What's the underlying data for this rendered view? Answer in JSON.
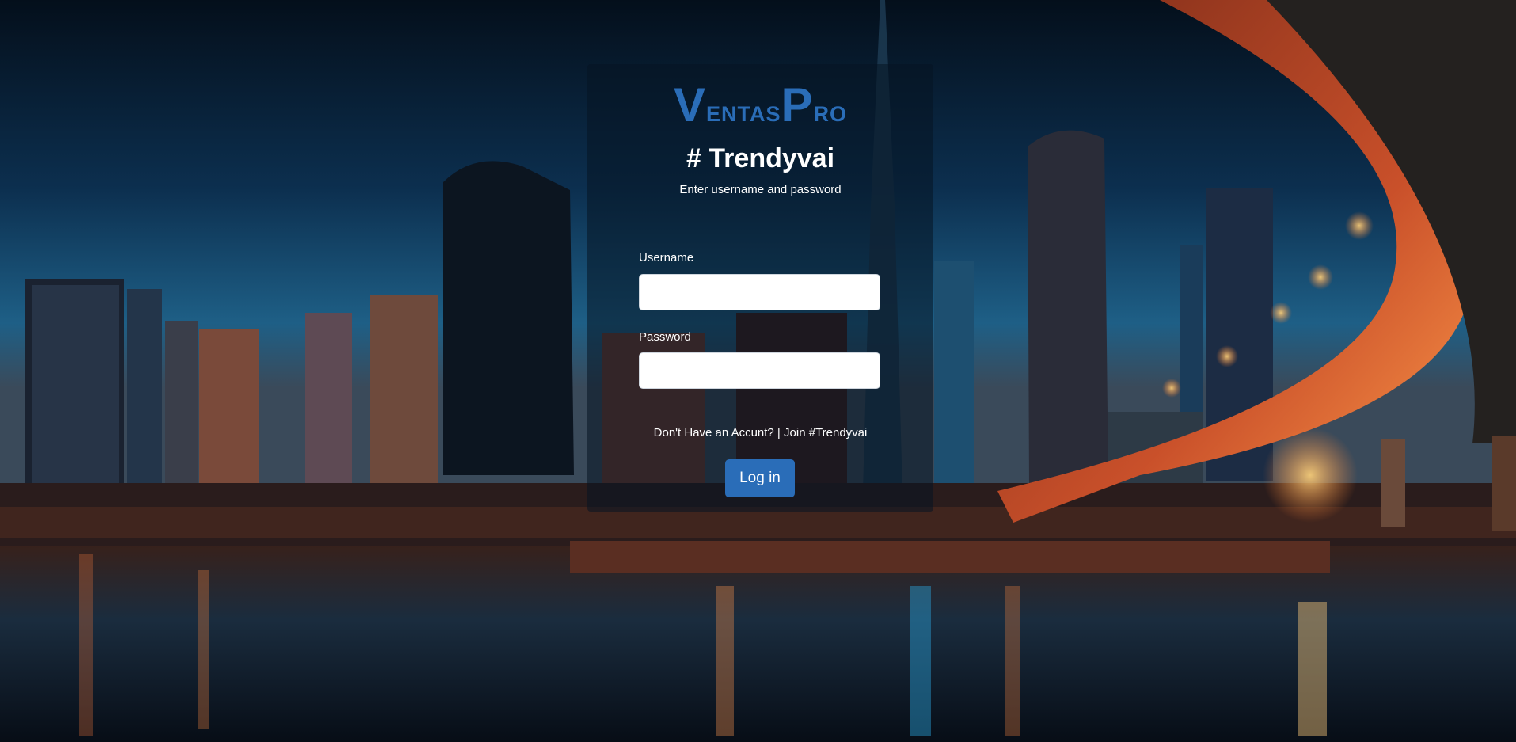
{
  "brand": {
    "logo_text_1": "V",
    "logo_text_2": "entas",
    "logo_text_3": "P",
    "logo_text_4": "ro"
  },
  "page": {
    "title": "# Trendyvai",
    "subtitle": "Enter username and password"
  },
  "form": {
    "username_label": "Username",
    "username_value": "",
    "password_label": "Password",
    "password_value": "",
    "signup_prompt": "Don't Have  an Accunt? |",
    "signup_link": "Join #Trendyvai",
    "submit_label": "Log in"
  },
  "colors": {
    "accent": "#2a6db8",
    "panel_bg": "rgba(5, 20, 35, 0.55)",
    "text": "#ffffff"
  }
}
